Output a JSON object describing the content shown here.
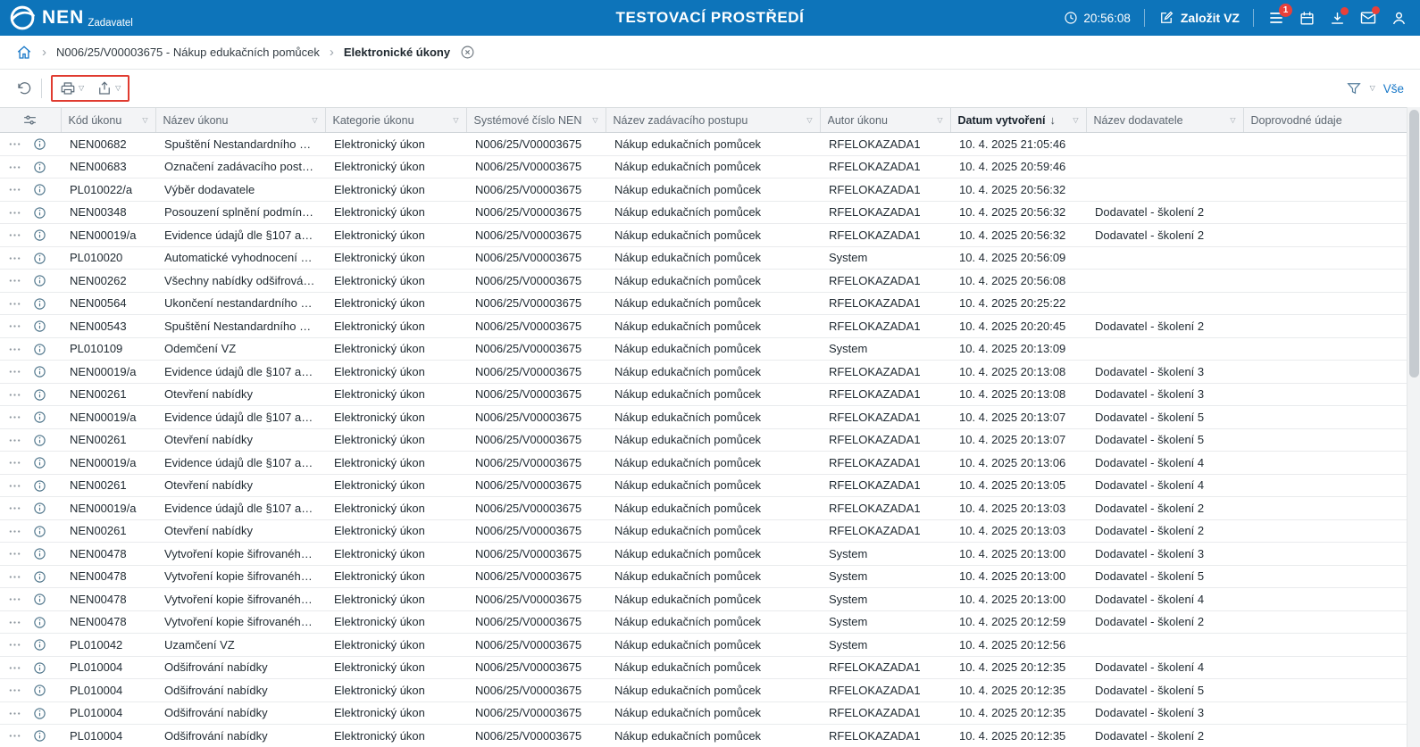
{
  "topbar": {
    "brand": "NEN",
    "brand_sub": "Zadavatel",
    "title": "TESTOVACÍ PROSTŘEDÍ",
    "clock": "20:56:08",
    "create_vz_label": "Založit VZ",
    "menu_badge": "1"
  },
  "breadcrumb": {
    "crumb1": "N006/25/V00003675 - Nákup edukačních pomůcek",
    "crumb2": "Elektronické úkony"
  },
  "toolbar": {
    "filter_scope_label": "Vše"
  },
  "table": {
    "columns": [
      {
        "label": "Kód úkonu",
        "filter": true
      },
      {
        "label": "Název úkonu",
        "filter": true
      },
      {
        "label": "Kategorie úkonu",
        "filter": true
      },
      {
        "label": "Systémové číslo NEN",
        "filter": true
      },
      {
        "label": "Název zadávacího postupu",
        "filter": true
      },
      {
        "label": "Autor úkonu",
        "filter": true
      },
      {
        "label": "Datum vytvoření",
        "filter": true,
        "sorted": "desc"
      },
      {
        "label": "Název dodavatele",
        "filter": true
      },
      {
        "label": "Doprovodné údaje",
        "filter": false
      }
    ],
    "rows": [
      [
        "NEN00682",
        "Spuštění Nestandardního st…",
        "Elektronický úkon",
        "N006/25/V00003675",
        "Nákup edukačních pomůcek",
        "RFELOKAZADA1",
        "10. 4. 2025 21:05:46",
        "",
        ""
      ],
      [
        "NEN00683",
        "Označení zadávacího postu…",
        "Elektronický úkon",
        "N006/25/V00003675",
        "Nákup edukačních pomůcek",
        "RFELOKAZADA1",
        "10. 4. 2025 20:59:46",
        "",
        ""
      ],
      [
        "PL010022/a",
        "Výběr dodavatele",
        "Elektronický úkon",
        "N006/25/V00003675",
        "Nákup edukačních pomůcek",
        "RFELOKAZADA1",
        "10. 4. 2025 20:56:32",
        "",
        ""
      ],
      [
        "NEN00348",
        "Posouzení splnění podmíne…",
        "Elektronický úkon",
        "N006/25/V00003675",
        "Nákup edukačních pomůcek",
        "RFELOKAZADA1",
        "10. 4. 2025 20:56:32",
        "Dodavatel - školení 2",
        ""
      ],
      [
        "NEN00019/a",
        "Evidence údajů dle §107 až …",
        "Elektronický úkon",
        "N006/25/V00003675",
        "Nákup edukačních pomůcek",
        "RFELOKAZADA1",
        "10. 4. 2025 20:56:32",
        "Dodavatel - školení 2",
        ""
      ],
      [
        "PL010020",
        "Automatické vyhodnocení n…",
        "Elektronický úkon",
        "N006/25/V00003675",
        "Nákup edukačních pomůcek",
        "System",
        "10. 4. 2025 20:56:09",
        "",
        ""
      ],
      [
        "NEN00262",
        "Všechny nabídky odšifrován…",
        "Elektronický úkon",
        "N006/25/V00003675",
        "Nákup edukačních pomůcek",
        "RFELOKAZADA1",
        "10. 4. 2025 20:56:08",
        "",
        ""
      ],
      [
        "NEN00564",
        "Ukončení nestandardního st…",
        "Elektronický úkon",
        "N006/25/V00003675",
        "Nákup edukačních pomůcek",
        "RFELOKAZADA1",
        "10. 4. 2025 20:25:22",
        "",
        ""
      ],
      [
        "NEN00543",
        "Spuštění Nestandardního st…",
        "Elektronický úkon",
        "N006/25/V00003675",
        "Nákup edukačních pomůcek",
        "RFELOKAZADA1",
        "10. 4. 2025 20:20:45",
        "Dodavatel - školení 2",
        ""
      ],
      [
        "PL010109",
        "Odemčení VZ",
        "Elektronický úkon",
        "N006/25/V00003675",
        "Nákup edukačních pomůcek",
        "System",
        "10. 4. 2025 20:13:09",
        "",
        ""
      ],
      [
        "NEN00019/a",
        "Evidence údajů dle §107 až …",
        "Elektronický úkon",
        "N006/25/V00003675",
        "Nákup edukačních pomůcek",
        "RFELOKAZADA1",
        "10. 4. 2025 20:13:08",
        "Dodavatel - školení 3",
        ""
      ],
      [
        "NEN00261",
        "Otevření nabídky",
        "Elektronický úkon",
        "N006/25/V00003675",
        "Nákup edukačních pomůcek",
        "RFELOKAZADA1",
        "10. 4. 2025 20:13:08",
        "Dodavatel - školení 3",
        ""
      ],
      [
        "NEN00019/a",
        "Evidence údajů dle §107 až …",
        "Elektronický úkon",
        "N006/25/V00003675",
        "Nákup edukačních pomůcek",
        "RFELOKAZADA1",
        "10. 4. 2025 20:13:07",
        "Dodavatel - školení 5",
        ""
      ],
      [
        "NEN00261",
        "Otevření nabídky",
        "Elektronický úkon",
        "N006/25/V00003675",
        "Nákup edukačních pomůcek",
        "RFELOKAZADA1",
        "10. 4. 2025 20:13:07",
        "Dodavatel - školení 5",
        ""
      ],
      [
        "NEN00019/a",
        "Evidence údajů dle §107 až …",
        "Elektronický úkon",
        "N006/25/V00003675",
        "Nákup edukačních pomůcek",
        "RFELOKAZADA1",
        "10. 4. 2025 20:13:06",
        "Dodavatel - školení 4",
        ""
      ],
      [
        "NEN00261",
        "Otevření nabídky",
        "Elektronický úkon",
        "N006/25/V00003675",
        "Nákup edukačních pomůcek",
        "RFELOKAZADA1",
        "10. 4. 2025 20:13:05",
        "Dodavatel - školení 4",
        ""
      ],
      [
        "NEN00019/a",
        "Evidence údajů dle §107 až …",
        "Elektronický úkon",
        "N006/25/V00003675",
        "Nákup edukačních pomůcek",
        "RFELOKAZADA1",
        "10. 4. 2025 20:13:03",
        "Dodavatel - školení 2",
        ""
      ],
      [
        "NEN00261",
        "Otevření nabídky",
        "Elektronický úkon",
        "N006/25/V00003675",
        "Nákup edukačních pomůcek",
        "RFELOKAZADA1",
        "10. 4. 2025 20:13:03",
        "Dodavatel - školení 2",
        ""
      ],
      [
        "NEN00478",
        "Vytvoření kopie šifrovaného …",
        "Elektronický úkon",
        "N006/25/V00003675",
        "Nákup edukačních pomůcek",
        "System",
        "10. 4. 2025 20:13:00",
        "Dodavatel - školení 3",
        ""
      ],
      [
        "NEN00478",
        "Vytvoření kopie šifrovaného …",
        "Elektronický úkon",
        "N006/25/V00003675",
        "Nákup edukačních pomůcek",
        "System",
        "10. 4. 2025 20:13:00",
        "Dodavatel - školení 5",
        ""
      ],
      [
        "NEN00478",
        "Vytvoření kopie šifrovaného …",
        "Elektronický úkon",
        "N006/25/V00003675",
        "Nákup edukačních pomůcek",
        "System",
        "10. 4. 2025 20:13:00",
        "Dodavatel - školení 4",
        ""
      ],
      [
        "NEN00478",
        "Vytvoření kopie šifrovaného …",
        "Elektronický úkon",
        "N006/25/V00003675",
        "Nákup edukačních pomůcek",
        "System",
        "10. 4. 2025 20:12:59",
        "Dodavatel - školení 2",
        ""
      ],
      [
        "PL010042",
        "Uzamčení VZ",
        "Elektronický úkon",
        "N006/25/V00003675",
        "Nákup edukačních pomůcek",
        "System",
        "10. 4. 2025 20:12:56",
        "",
        ""
      ],
      [
        "PL010004",
        "Odšifrování nabídky",
        "Elektronický úkon",
        "N006/25/V00003675",
        "Nákup edukačních pomůcek",
        "RFELOKAZADA1",
        "10. 4. 2025 20:12:35",
        "Dodavatel - školení 4",
        ""
      ],
      [
        "PL010004",
        "Odšifrování nabídky",
        "Elektronický úkon",
        "N006/25/V00003675",
        "Nákup edukačních pomůcek",
        "RFELOKAZADA1",
        "10. 4. 2025 20:12:35",
        "Dodavatel - školení 5",
        ""
      ],
      [
        "PL010004",
        "Odšifrování nabídky",
        "Elektronický úkon",
        "N006/25/V00003675",
        "Nákup edukačních pomůcek",
        "RFELOKAZADA1",
        "10. 4. 2025 20:12:35",
        "Dodavatel - školení 3",
        ""
      ],
      [
        "PL010004",
        "Odšifrování nabídky",
        "Elektronický úkon",
        "N006/25/V00003675",
        "Nákup edukačních pomůcek",
        "RFELOKAZADA1",
        "10. 4. 2025 20:12:35",
        "Dodavatel - školení 2",
        ""
      ]
    ]
  }
}
